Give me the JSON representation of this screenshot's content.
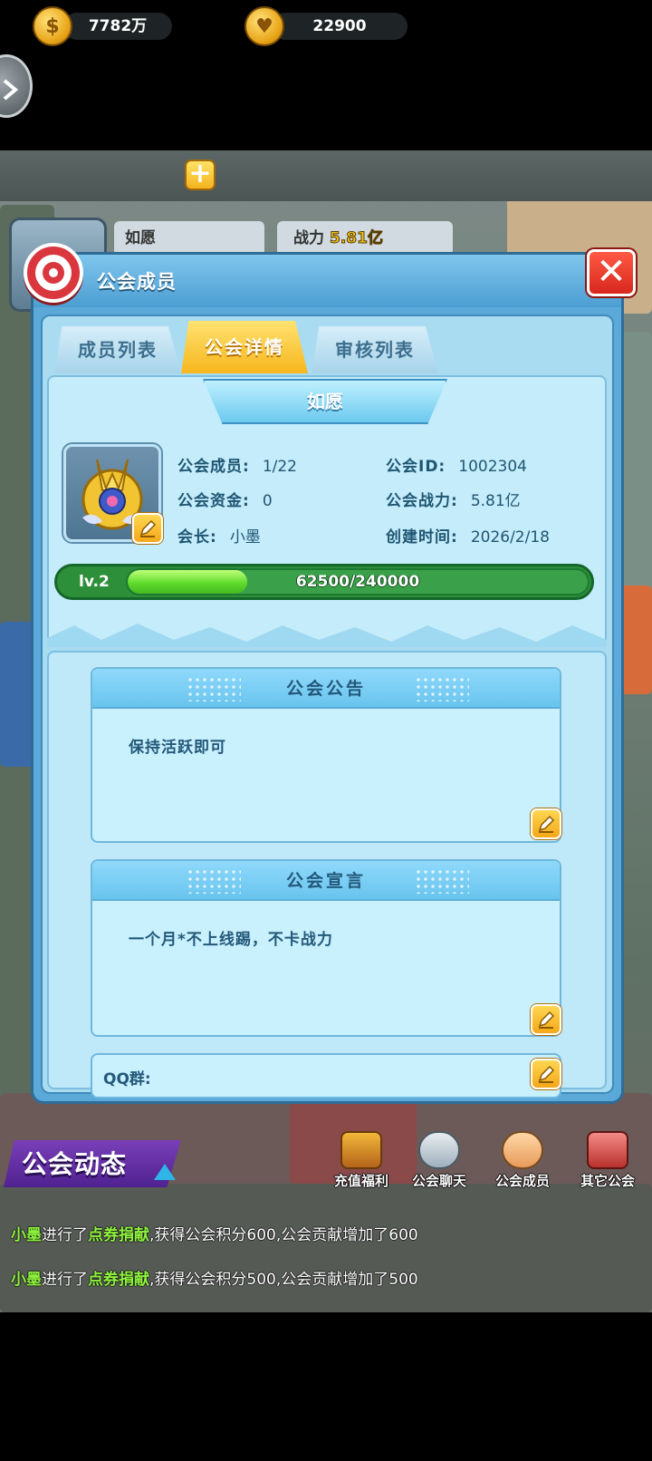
{
  "resources": {
    "gold": "7782万",
    "gold_icon": "coin-icon",
    "medal": "22900",
    "medal_icon": "rabbit-medal-icon"
  },
  "player": {
    "name": "如愿",
    "power_label": "战力",
    "power_value": "5.81亿"
  },
  "dialog": {
    "title": "公会成员",
    "tabs": [
      "成员列表",
      "公会详情",
      "审核列表"
    ],
    "active_tab": 1
  },
  "guild": {
    "name": "如愿",
    "members_label": "公会成员:",
    "members_value": "1/22",
    "id_label": "公会ID:",
    "id_value": "1002304",
    "funds_label": "公会资金:",
    "funds_value": "0",
    "power_label": "公会战力:",
    "power_value": "5.81亿",
    "leader_label": "会长:",
    "leader_value": "小墨",
    "created_label": "创建时间:",
    "created_value": "2026/2/18",
    "level_label": "lv.2",
    "exp_current": 62500,
    "exp_max": 240000,
    "exp_text": "62500/240000"
  },
  "announcement": {
    "title": "公会公告",
    "text": "保持活跃即可"
  },
  "declaration": {
    "title": "公会宣言",
    "text": "一个月*不上线踢，不卡战力"
  },
  "qq": {
    "label": "QQ群:"
  },
  "activity": {
    "title": "公会动态",
    "menu": [
      {
        "label": "充值福利",
        "icon": "treasure-chest-icon"
      },
      {
        "label": "公会聊天",
        "icon": "chat-group-icon"
      },
      {
        "label": "公会成员",
        "icon": "members-icon"
      },
      {
        "label": "其它公会",
        "icon": "guild-shop-icon"
      }
    ],
    "logs": [
      {
        "name": "小墨",
        "verb": "进行了",
        "action": "点券捐献",
        "rest": ",获得公会积分600,公会贡献增加了600"
      },
      {
        "name": "小墨",
        "verb": "进行了",
        "action": "点券捐献",
        "rest": ",获得公会积分500,公会贡献增加了500"
      }
    ]
  },
  "colors": {
    "dialog_blue": "#5aa9d8",
    "tab_active": "#f7b61d",
    "progress_green": "#5fdc2e",
    "close_red": "#d8261c",
    "activity_purple": "#5a2a9a"
  }
}
